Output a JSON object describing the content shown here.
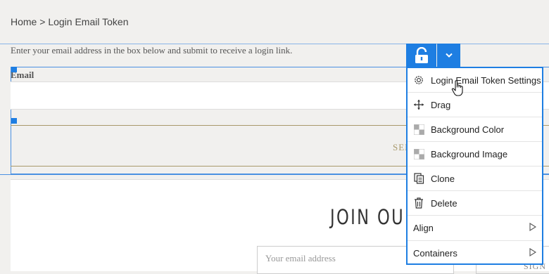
{
  "breadcrumb": {
    "home": "Home",
    "separator": ">",
    "current": "Login Email Token"
  },
  "form": {
    "intro": "Enter your email address in the box below and submit to receive a login link.",
    "email_label": "Email",
    "send_label": "SEN"
  },
  "footer": {
    "join_title": "JOIN OUR",
    "email_placeholder": "Your email address",
    "sign_label": "SIGN"
  },
  "toolbar": {
    "lock_icon": "unlock-icon",
    "dropdown_icon": "chevron-down-icon"
  },
  "context_menu": {
    "items": [
      {
        "label": "Login Email Token Settings",
        "icon": "gear-icon"
      },
      {
        "label": "Drag",
        "icon": "move-icon"
      },
      {
        "label": "Background Color",
        "icon": "checker-icon"
      },
      {
        "label": "Background Image",
        "icon": "checker-icon"
      },
      {
        "label": "Clone",
        "icon": "clone-icon"
      },
      {
        "label": "Delete",
        "icon": "trash-icon"
      },
      {
        "label": "Align",
        "icon": "submenu-arrow-icon"
      },
      {
        "label": "Containers",
        "icon": "submenu-arrow-icon"
      }
    ]
  },
  "colors": {
    "accent": "#1e7ee2",
    "gold": "#a8996b"
  }
}
